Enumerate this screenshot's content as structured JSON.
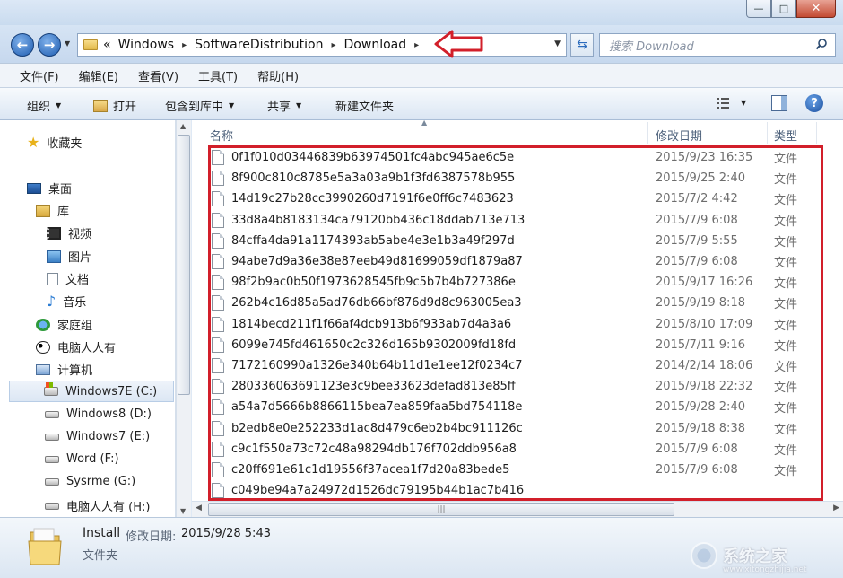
{
  "window": {
    "controls": {
      "minimize": "—",
      "maximize": "□",
      "close": "✕"
    }
  },
  "address_bar": {
    "overflow": "«",
    "crumbs": [
      "Windows",
      "SoftwareDistribution",
      "Download"
    ],
    "separator": "▸",
    "search_placeholder": "搜索 Download"
  },
  "menu": [
    "文件(F)",
    "编辑(E)",
    "查看(V)",
    "工具(T)",
    "帮助(H)"
  ],
  "toolbar": {
    "organize": "组织",
    "open": "打开",
    "include_in_library": "包含到库中",
    "share": "共享",
    "new_folder": "新建文件夹",
    "help": "?"
  },
  "nav": {
    "favorites": "收藏夹",
    "desktop": "桌面",
    "libraries": "库",
    "lib_items": [
      "视频",
      "图片",
      "文档",
      "音乐"
    ],
    "homegroup": "家庭组",
    "user": "电脑人人有",
    "computer": "计算机",
    "drives": [
      "Windows7E (C:)",
      "Windows8 (D:)",
      "Windows7 (E:)",
      "Word (F:)",
      "Sysrme (G:)",
      "电脑人人有 (H:)"
    ],
    "selected_drive": "Windows7E (C:)"
  },
  "columns": {
    "name": "名称",
    "date": "修改日期",
    "type": "类型"
  },
  "files": [
    {
      "name": "0f1f010d03446839b63974501fc4abc945ae6c5e",
      "date": "2015/9/23 16:35",
      "type": "文件"
    },
    {
      "name": "8f900c810c8785e5a3a03a9b1f3fd6387578b955",
      "date": "2015/9/25 2:40",
      "type": "文件"
    },
    {
      "name": "14d19c27b28cc3990260d7191f6e0ff6c7483623",
      "date": "2015/7/2 4:42",
      "type": "文件"
    },
    {
      "name": "33d8a4b8183134ca79120bb436c18ddab713e713",
      "date": "2015/7/9 6:08",
      "type": "文件"
    },
    {
      "name": "84cffa4da91a1174393ab5abe4e3e1b3a49f297d",
      "date": "2015/7/9 5:55",
      "type": "文件"
    },
    {
      "name": "94abe7d9a36e38e87eeb49d81699059df1879a87",
      "date": "2015/7/9 6:08",
      "type": "文件"
    },
    {
      "name": "98f2b9ac0b50f1973628545fb9c5b7b4b727386e",
      "date": "2015/9/17 16:26",
      "type": "文件"
    },
    {
      "name": "262b4c16d85a5ad76db66bf876d9d8c963005ea3",
      "date": "2015/9/19 8:18",
      "type": "文件"
    },
    {
      "name": "1814becd211f1f66af4dcb913b6f933ab7d4a3a6",
      "date": "2015/8/10 17:09",
      "type": "文件"
    },
    {
      "name": "6099e745fd461650c2c326d165b9302009fd18fd",
      "date": "2015/7/11 9:16",
      "type": "文件"
    },
    {
      "name": "7172160990a1326e340b64b11d1e1ee12f0234c7",
      "date": "2014/2/14 18:06",
      "type": "文件"
    },
    {
      "name": "280336063691123e3c9bee33623defad813e85ff",
      "date": "2015/9/18 22:32",
      "type": "文件"
    },
    {
      "name": "a54a7d5666b8866115bea7ea859faa5bd754118e",
      "date": "2015/9/28 2:40",
      "type": "文件"
    },
    {
      "name": "b2edb8e0e252233d1ac8d479c6eb2b4bc911126c",
      "date": "2015/9/18 8:38",
      "type": "文件"
    },
    {
      "name": "c9c1f550a73c72c48a98294db176f702ddb956a8",
      "date": "2015/7/9 6:08",
      "type": "文件"
    },
    {
      "name": "c20ff691e61c1d19556f37acea1f7d20a83bede5",
      "date": "2015/7/9 6:08",
      "type": "文件"
    },
    {
      "name": "c049be94a7a24972d1526dc79195b44b1ac7b416",
      "date": "",
      "type": ""
    }
  ],
  "details": {
    "name": "Install",
    "modified_label": "修改日期:",
    "modified_value": "2015/9/28 5:43",
    "type": "文件夹"
  },
  "watermark": {
    "text": "系统之家",
    "url": "www.xitongzhijia.net"
  },
  "colors": {
    "highlight_box": "#d21f2a",
    "arrow": "#d21f2a"
  }
}
